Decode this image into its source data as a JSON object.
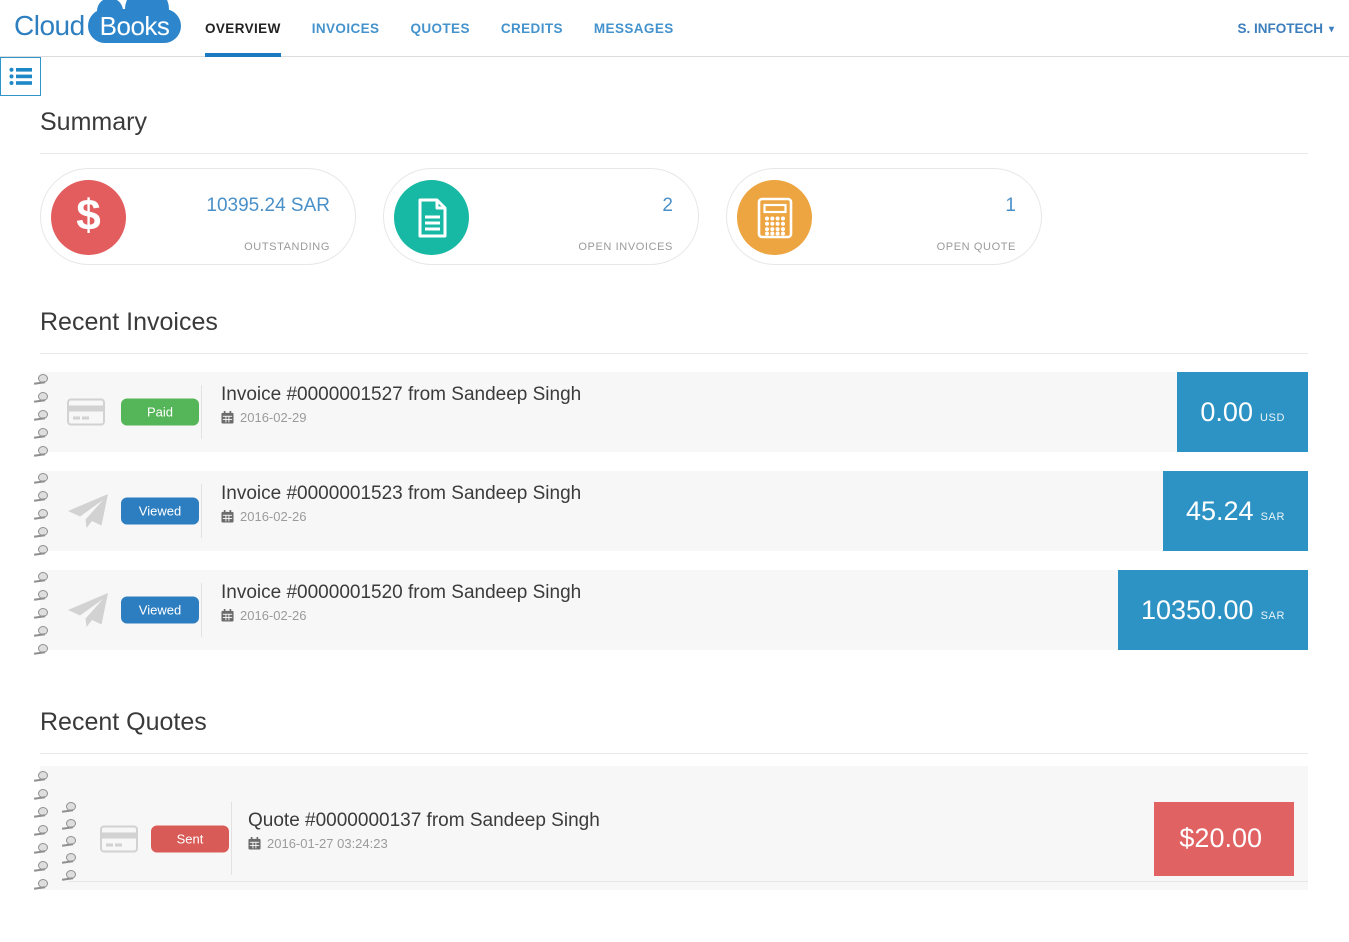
{
  "colors": {
    "brand_blue": "#2d86cb",
    "nav_blue": "#4593cd",
    "active_tab_underline": "#1c79c0",
    "accent_text_blue": "#4a90c8",
    "outstanding_red": "#e35d5e",
    "invoices_teal": "#17b9a4",
    "quote_orange": "#eca541",
    "paid_green": "#55b559",
    "viewed_blue": "#2d7ec0",
    "sent_red": "#d95b57",
    "amount_blue": "#2d93c4",
    "amount_red": "#e16263"
  },
  "header": {
    "logo": {
      "word1": "Cloud",
      "word2": "Books"
    },
    "nav": [
      {
        "label": "OVERVIEW",
        "active": true
      },
      {
        "label": "INVOICES",
        "active": false
      },
      {
        "label": "QUOTES",
        "active": false
      },
      {
        "label": "CREDITS",
        "active": false
      },
      {
        "label": "MESSAGES",
        "active": false
      }
    ],
    "user_menu": "S. INFOTECH"
  },
  "summary": {
    "title": "Summary",
    "cards": [
      {
        "icon": "dollar-icon",
        "glyph": "$",
        "circle_color": "#e35d5e",
        "value": "10395.24 SAR",
        "label": "OUTSTANDING"
      },
      {
        "icon": "invoice-document-icon",
        "circle_color": "#17b9a4",
        "value": "2",
        "label": "OPEN INVOICES"
      },
      {
        "icon": "calculator-icon",
        "circle_color": "#eca541",
        "value": "1",
        "label": "OPEN QUOTE"
      }
    ]
  },
  "recent_invoices": {
    "title": "Recent Invoices",
    "rows": [
      {
        "icon": "credit-card-icon",
        "status": "Paid",
        "status_color": "#55b559",
        "title": "Invoice #0000001527 from Sandeep Singh",
        "date": "2016-02-29",
        "amount": "0.00",
        "currency": "USD",
        "amount_bg": "#2d93c4"
      },
      {
        "icon": "paper-plane-icon",
        "status": "Viewed",
        "status_color": "#2d7ec0",
        "title": "Invoice #0000001523 from Sandeep Singh",
        "date": "2016-02-26",
        "amount": "45.24",
        "currency": "SAR",
        "amount_bg": "#2d93c4"
      },
      {
        "icon": "paper-plane-icon",
        "status": "Viewed",
        "status_color": "#2d7ec0",
        "title": "Invoice #0000001520 from Sandeep Singh",
        "date": "2016-02-26",
        "amount": "10350.00",
        "currency": "SAR",
        "amount_bg": "#2d93c4"
      }
    ]
  },
  "recent_quotes": {
    "title": "Recent Quotes",
    "rows": [
      {
        "icon": "credit-card-icon",
        "status": "Sent",
        "status_color": "#d95b57",
        "title": "Quote #0000000137 from Sandeep Singh",
        "date": "2016-01-27 03:24:23",
        "amount": "$20.00",
        "currency": "",
        "amount_bg": "#e16263"
      }
    ]
  }
}
